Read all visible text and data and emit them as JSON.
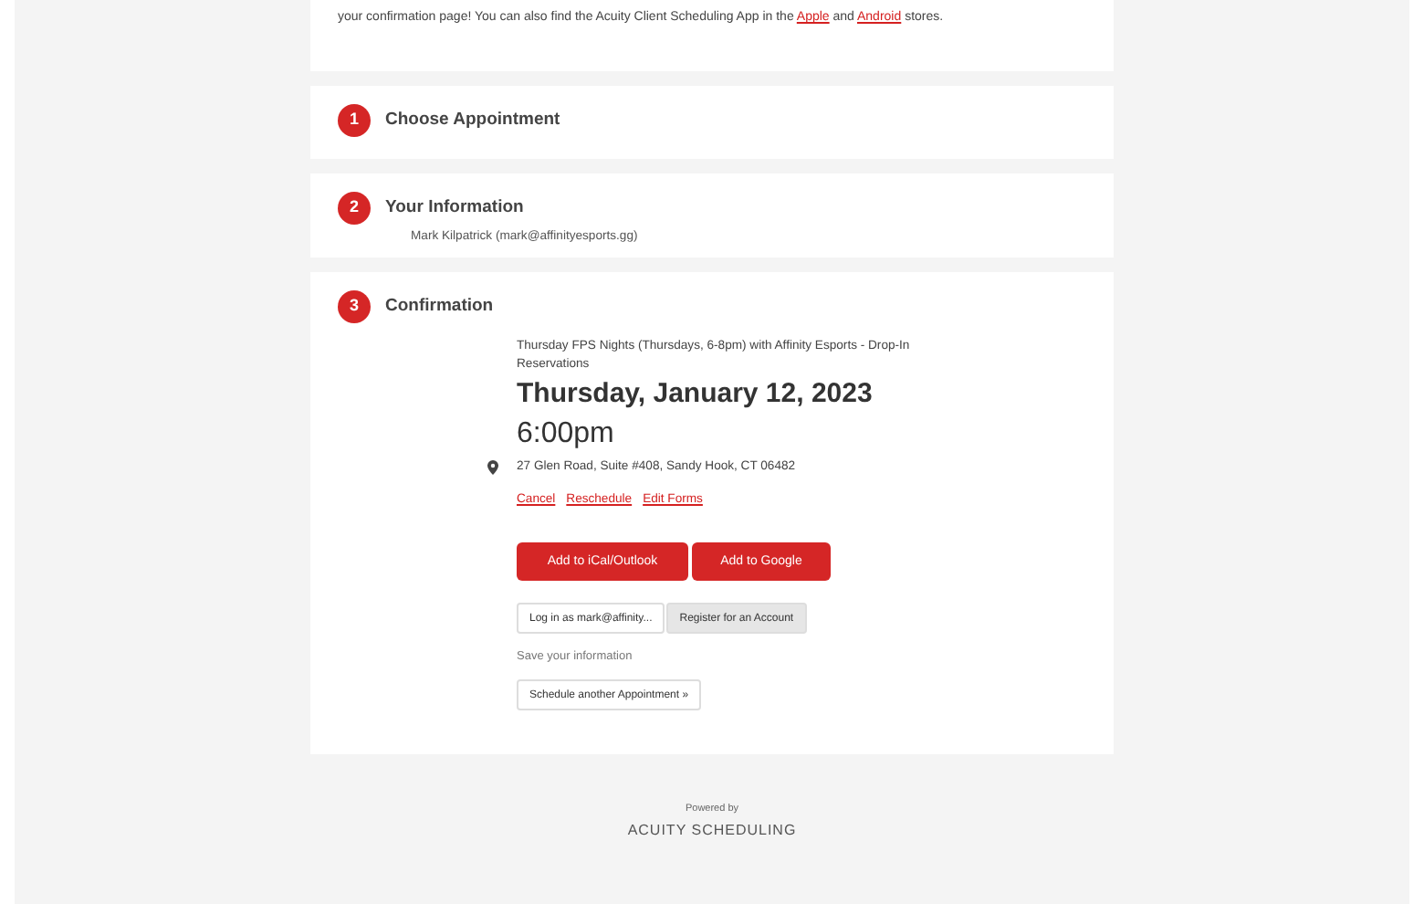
{
  "intro": {
    "text_before": "your confirmation page! You can also find the Acuity Client Scheduling App in the ",
    "links": [
      "Apple",
      "Android"
    ],
    "joiner": " and ",
    "text_after": " stores."
  },
  "steps": [
    {
      "number": "1",
      "title": "Choose Appointment"
    },
    {
      "number": "2",
      "title": "Your Information",
      "detail": "Mark Kilpatrick (mark@affinityesports.gg)"
    },
    {
      "number": "3",
      "title": "Confirmation"
    }
  ],
  "confirmation": {
    "appointment_type": "Thursday FPS Nights (Thursdays, 6-8pm) with Affinity Esports - Drop-In Reservations",
    "date": "Thursday, January 12, 2023",
    "time": "6:00pm",
    "address": "27 Glen Road, Suite #408, Sandy Hook, CT 06482",
    "links": [
      "Cancel",
      "Reschedule",
      "Edit Forms"
    ],
    "calendar_buttons": [
      "Add to iCal/Outlook",
      "Add to Google"
    ],
    "account_buttons": [
      {
        "label": "Log in as mark@affinity...",
        "selected": false
      },
      {
        "label": "Register for an Account",
        "selected": true
      }
    ],
    "account_hint": "Save your information",
    "schedule_button": "Schedule another Appointment »"
  },
  "footer": {
    "powered_by": "Powered by",
    "brand": "ACUITY SCHEDULING"
  }
}
